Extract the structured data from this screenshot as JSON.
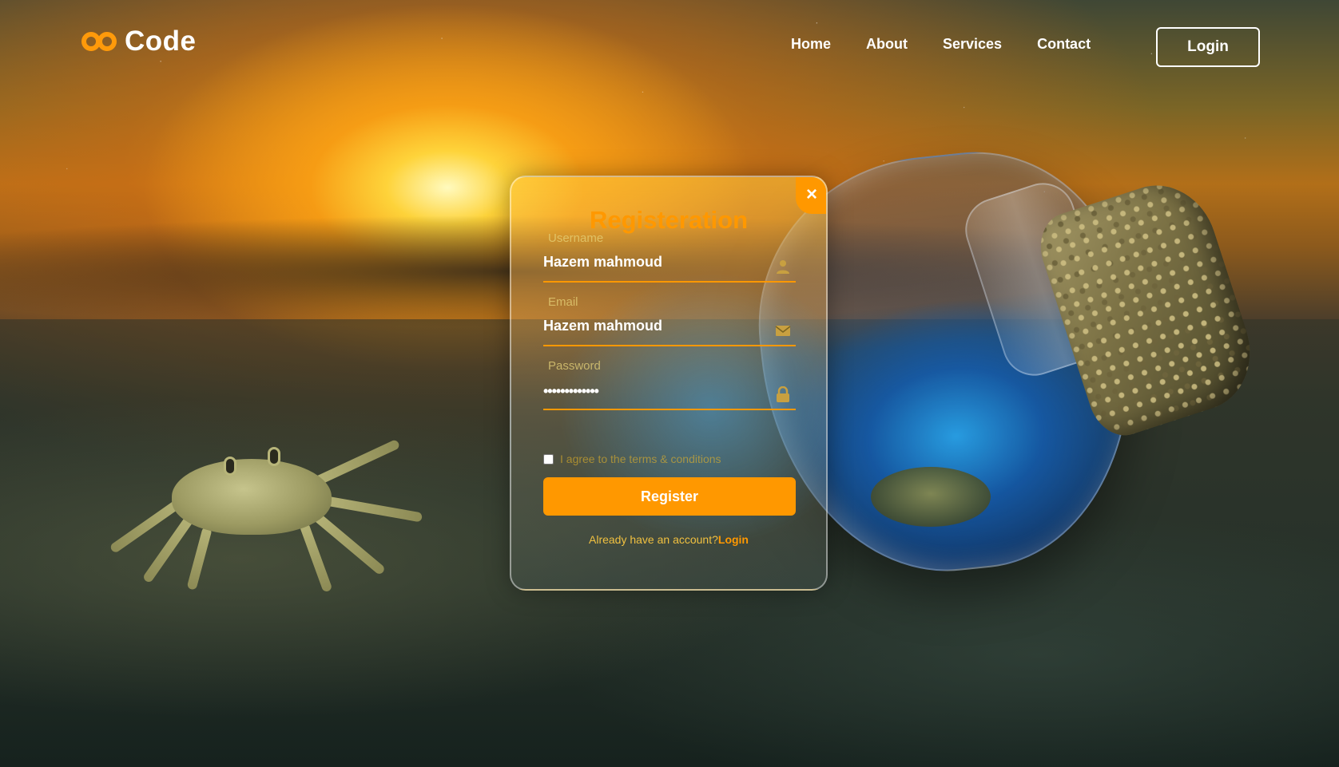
{
  "brand": {
    "name": "Code",
    "accent": "#ff9800"
  },
  "nav": {
    "items": [
      {
        "label": "Home"
      },
      {
        "label": "About"
      },
      {
        "label": "Services"
      },
      {
        "label": "Contact"
      }
    ],
    "login_label": "Login"
  },
  "card": {
    "title": "Registeration",
    "close_glyph": "×",
    "fields": {
      "username": {
        "label": "Username",
        "value": "Hazem mahmoud",
        "icon": "user-icon"
      },
      "email": {
        "label": "Email",
        "value": "Hazem mahmoud",
        "icon": "mail-icon"
      },
      "password": {
        "label": "Password",
        "value": "•••••••••••••",
        "icon": "lock-icon"
      }
    },
    "terms_label": "I agree to the terms & conditions",
    "terms_checked": false,
    "register_label": "Register",
    "account_prompt": "Already have an account?",
    "account_link": "Login"
  }
}
